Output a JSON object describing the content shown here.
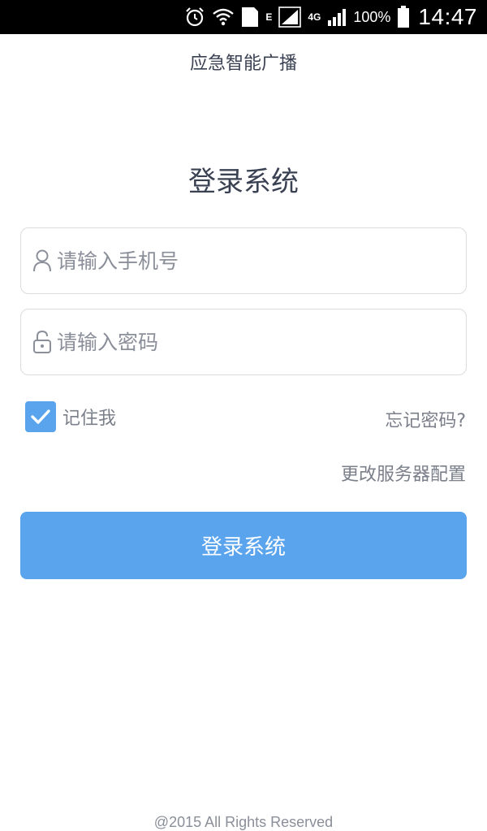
{
  "status_bar": {
    "network_e": "E",
    "network_4g": "4G",
    "battery_percent": "100%",
    "time": "14:47",
    "sim_slot": "1",
    "icons": [
      "alarm-icon",
      "wifi-icon",
      "sim-icon",
      "signal-icon",
      "signal-icon",
      "battery-icon"
    ]
  },
  "app": {
    "title": "应急智能广播"
  },
  "login": {
    "heading": "登录系统",
    "phone_placeholder": "请输入手机号",
    "phone_value": "",
    "password_placeholder": "请输入密码",
    "password_value": "",
    "remember_label": "记住我",
    "remember_checked": true,
    "forgot_label": "忘记密码?",
    "server_config_label": "更改服务器配置",
    "submit_label": "登录系统"
  },
  "footer": {
    "copyright": "@2015 All Rights Reserved"
  },
  "colors": {
    "accent": "#5aa4ee",
    "text_dark": "#3a4152",
    "text_muted": "#7a7f8a",
    "border": "#dcdcdc"
  }
}
